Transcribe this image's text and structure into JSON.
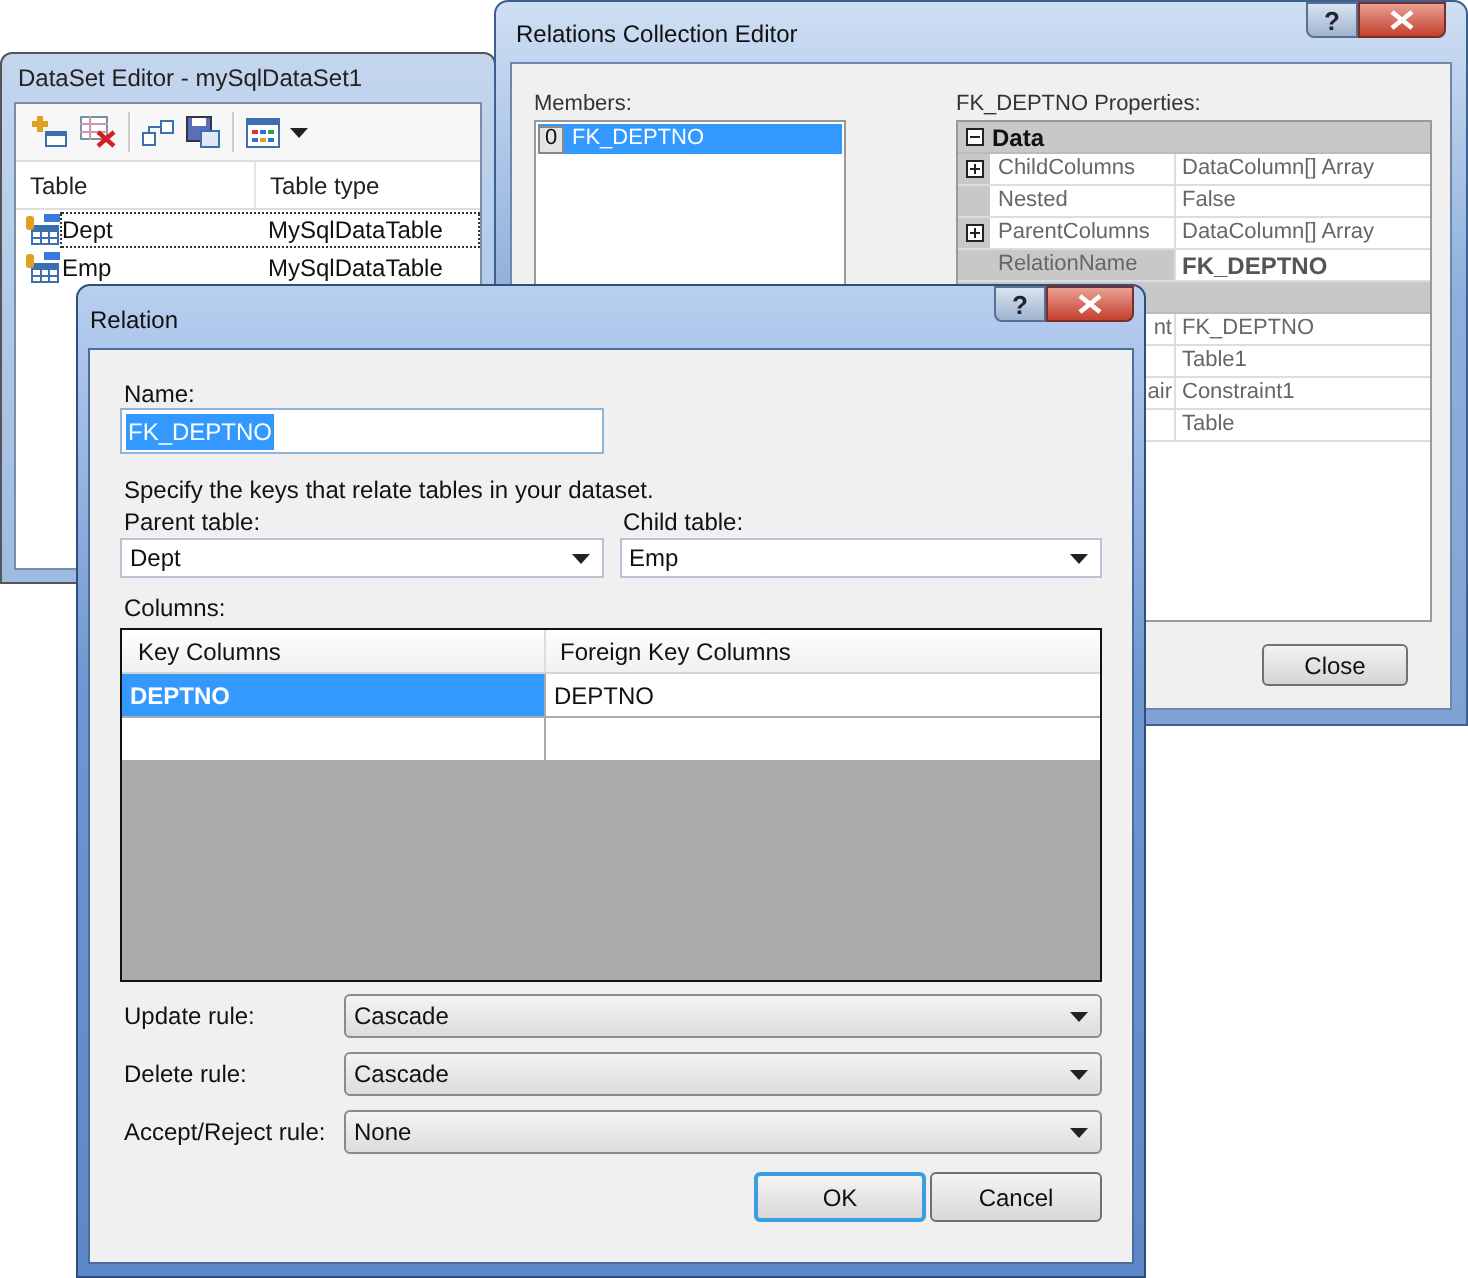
{
  "dataset_editor": {
    "title": "DataSet Editor - mySqlDataSet1",
    "columns": [
      "Table",
      "Table type"
    ],
    "rows": [
      {
        "name": "Dept",
        "type": "MySqlDataTable",
        "selected": true
      },
      {
        "name": "Emp",
        "type": "MySqlDataTable",
        "selected": false
      }
    ]
  },
  "relations_editor": {
    "title": "Relations Collection Editor",
    "help_button": "?",
    "members_label": "Members:",
    "members": [
      {
        "index": "0",
        "name": "FK_DEPTNO",
        "selected": true
      }
    ],
    "properties_label": "FK_DEPTNO Properties:",
    "categories": [
      {
        "name": "Data",
        "expanded": true,
        "properties": [
          {
            "kind": "expandable",
            "name": "ChildColumns",
            "value": "DataColumn[] Array",
            "selected": false,
            "modified": false
          },
          {
            "kind": "plain",
            "name": "Nested",
            "value": "False",
            "selected": false,
            "modified": false
          },
          {
            "kind": "expandable",
            "name": "ParentColumns",
            "value": "DataColumn[] Array",
            "selected": false,
            "modified": false
          },
          {
            "kind": "plain",
            "name": "RelationName",
            "value": "FK_DEPTNO",
            "selected": true,
            "modified": true
          }
        ]
      },
      {
        "properties": [
          {
            "name": "nt",
            "value": "FK_DEPTNO",
            "selected": false,
            "modified": false
          },
          {
            "value": "Table1",
            "selected": false,
            "modified": false
          },
          {
            "name": "air",
            "value": "Constraint1",
            "selected": false,
            "modified": false
          },
          {
            "value": "Table",
            "selected": false,
            "modified": false
          }
        ]
      }
    ],
    "close_button": "Close"
  },
  "relation_dialog": {
    "title": "Relation",
    "help_button": "?",
    "name_label": "Name:",
    "name_value": "FK_DEPTNO",
    "name_text_selected": true,
    "hint": "Specify the keys that relate tables in your dataset.",
    "parent_table": {
      "label": "Parent table:",
      "value": "Dept"
    },
    "child_table": {
      "label": "Child table:",
      "value": "Emp"
    },
    "columns_label": "Columns:",
    "grid": {
      "columns": [
        "Key Columns",
        "Foreign Key Columns"
      ],
      "rows": [
        {
          "key": "DEPTNO",
          "foreign": "DEPTNO",
          "selected": true
        }
      ],
      "new_row": true
    },
    "rules": [
      {
        "label": "Update rule:",
        "value": "Cascade"
      },
      {
        "label": "Delete rule:",
        "value": "Cascade"
      },
      {
        "label": "Accept/Reject rule:",
        "value": "None"
      }
    ],
    "buttons": [
      {
        "label": "OK",
        "default": true
      },
      {
        "label": "Cancel",
        "default": false
      }
    ]
  }
}
